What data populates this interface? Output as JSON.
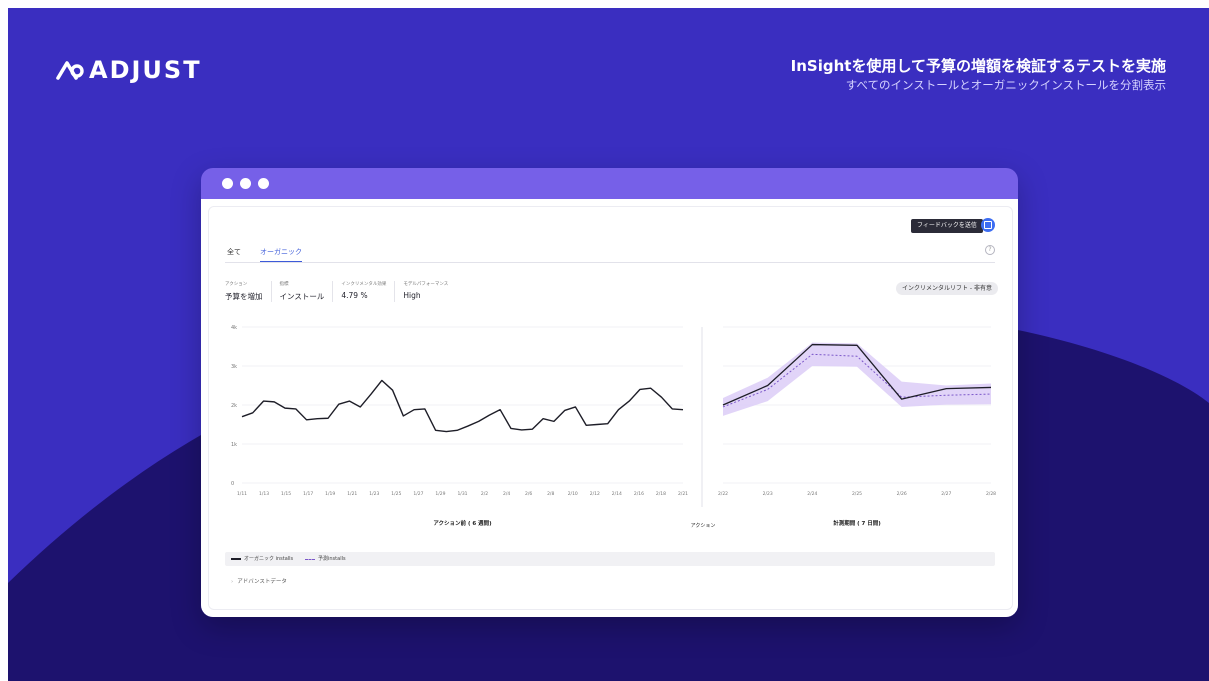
{
  "brand": {
    "logo_text": "ADJUST"
  },
  "headline": {
    "title": "InSightを使用して予算の増額を検証するテストを実施",
    "subtitle": "すべてのインストールとオーガニックインストールを分割表示"
  },
  "colors": {
    "background": "#3a2ec0",
    "wave": "#1d126e",
    "browser_bar": "#7660e8",
    "accent": "#3d5bd9",
    "actual_line": "#1e1e28",
    "forecast_line": "#7b57c9",
    "band": "#dccdf7"
  },
  "browser": {
    "window_dots": 3
  },
  "toolbar": {
    "feedback_tooltip": "フィードバックを送信",
    "feedback_icon": "feedback-icon"
  },
  "tabs": [
    {
      "label": "全て",
      "active": false
    },
    {
      "label": "オーガニック",
      "active": true
    }
  ],
  "help_icon": "?",
  "metrics": [
    {
      "label": "アクション",
      "value": "予算を増加"
    },
    {
      "label": "指標",
      "value": "インストール"
    },
    {
      "label": "インクリメンタル効果",
      "value": "4.79 %"
    },
    {
      "label": "モデルパフォーマンス",
      "value": "High"
    }
  ],
  "lift_badge": "インクリメンタルリフト - 非有意",
  "chart_data": [
    {
      "type": "line",
      "title": "",
      "xlabel": "アクション前 ( 6 週間)",
      "ylabel": "",
      "ylim": [
        0,
        4000
      ],
      "y_ticks": [
        "0",
        "1k",
        "2k",
        "3k",
        "4k"
      ],
      "x_tick_labels": [
        "1/11",
        "1/13",
        "1/15",
        "1/17",
        "1/19",
        "1/21",
        "1/23",
        "1/25",
        "1/27",
        "1/29",
        "1/31",
        "2/2",
        "2/4",
        "2/6",
        "2/8",
        "2/10",
        "2/12",
        "2/14",
        "2/16",
        "2/18",
        "2/21"
      ],
      "grid": true,
      "series": [
        {
          "name": "オーガニック installs",
          "values": [
            1700,
            1800,
            2100,
            2080,
            1920,
            1900,
            1620,
            1650,
            1660,
            2020,
            2100,
            1950,
            2280,
            2630,
            2380,
            1720,
            1880,
            1900,
            1350,
            1320,
            1350,
            1460,
            1580,
            1740,
            1880,
            1400,
            1360,
            1380,
            1650,
            1580,
            1860,
            1950,
            1480,
            1500,
            1520,
            1880,
            2100,
            2400,
            2430,
            2200,
            1900,
            1880
          ]
        }
      ]
    },
    {
      "type": "line",
      "title": "",
      "xlabel": "計測期間 ( 7 日間)",
      "ylabel": "",
      "ylim": [
        0,
        4000
      ],
      "x_tick_labels": [
        "2/22",
        "2/23",
        "2/24",
        "2/25",
        "2/26",
        "2/27",
        "2/28"
      ],
      "grid": true,
      "series": [
        {
          "name": "オーガニック installs",
          "values": [
            2000,
            2500,
            3550,
            3530,
            2150,
            2420,
            2450
          ]
        },
        {
          "name": "予測installs",
          "values": [
            1950,
            2400,
            3300,
            3250,
            2200,
            2250,
            2280
          ],
          "band_low": [
            1720,
            2100,
            3000,
            2980,
            1950,
            2010,
            2020
          ],
          "band_high": [
            2180,
            2700,
            3600,
            3580,
            2600,
            2500,
            2550
          ]
        }
      ]
    }
  ],
  "action_divider_label": "アクション",
  "legend": [
    {
      "label": "オーガニック installs",
      "style": "solid"
    },
    {
      "label": "予測installs",
      "style": "dashed"
    }
  ],
  "advanced_data": {
    "label": "アドバンストデータ",
    "icon": "chevron-right-icon"
  }
}
